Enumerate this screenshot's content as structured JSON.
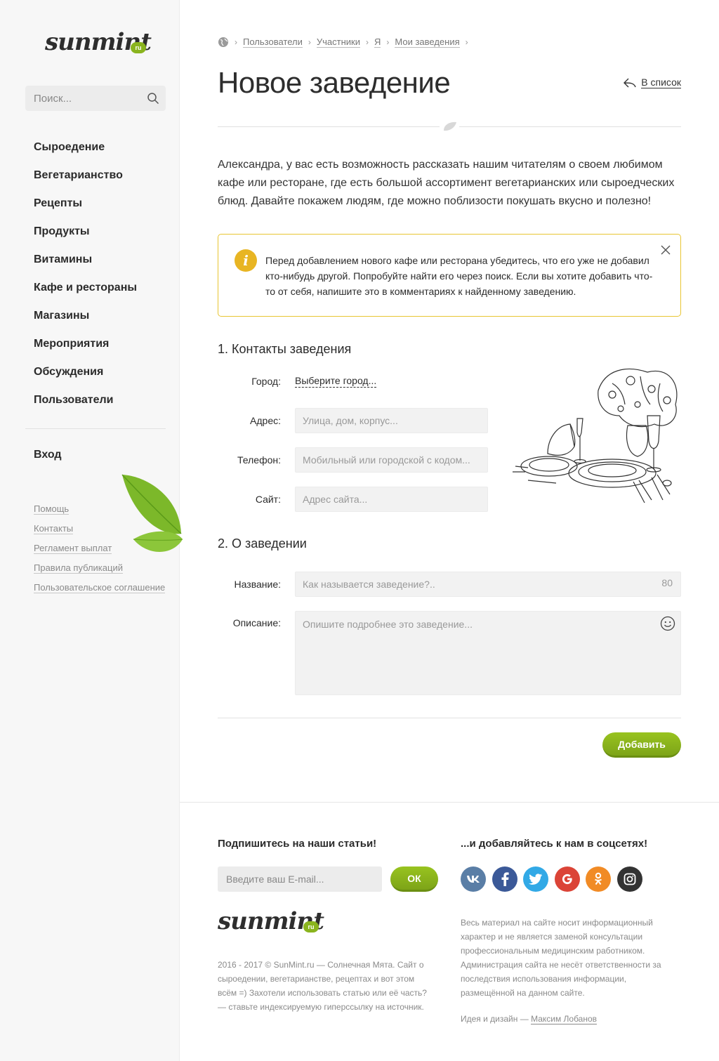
{
  "sidebar": {
    "logo_text": "sunmint",
    "logo_badge": "ru",
    "search_placeholder": "Поиск...",
    "nav": [
      "Сыроедение",
      "Вегетарианство",
      "Рецепты",
      "Продукты",
      "Витамины",
      "Кафе и рестораны",
      "Магазины",
      "Мероприятия",
      "Обсуждения",
      "Пользователи"
    ],
    "login": "Вход",
    "links": [
      "Помощь",
      "Контакты",
      "Регламент выплат",
      "Правила публикаций",
      "Пользовательское соглашение"
    ]
  },
  "breadcrumb": [
    "Пользователи",
    "Участники",
    "Я",
    "Мои заведения"
  ],
  "header": {
    "title": "Новое заведение",
    "back_link": "В список"
  },
  "intro": "Александра, у вас есть возможность рассказать нашим читателям о своем любимом кафе или ресторане, где есть большой ассортимент вегетарианских или сыроедческих блюд. Давайте покажем людям, где можно поблизости покушать вкусно и полезно!",
  "notice": {
    "icon": "i",
    "text": "Перед добавлением нового кафе или ресторана убедитесь, что его уже не добавил кто-нибудь другой. Попробуйте найти его через поиск. Если вы хотите добавить что-то от себя, напишите это в комментариях к найденному заведению."
  },
  "section1": {
    "title": "1. Контакты заведения",
    "city_label": "Город:",
    "city_value": "Выберите город...",
    "address_label": "Адрес:",
    "address_placeholder": "Улица, дом, корпус...",
    "phone_label": "Телефон:",
    "phone_placeholder": "Мобильный или городской с кодом...",
    "site_label": "Сайт:",
    "site_placeholder": "Адрес сайта..."
  },
  "section2": {
    "title": "2. О заведении",
    "name_label": "Название:",
    "name_placeholder": "Как называется заведение?..",
    "name_counter": "80",
    "desc_label": "Описание:",
    "desc_placeholder": "Опишите подробнее это заведение..."
  },
  "submit_label": "Добавить",
  "footer": {
    "subscribe_title": "Подпишитесь на наши статьи!",
    "email_placeholder": "Введите ваш E-mail...",
    "ok_label": "ОК",
    "social_title": "...и добавляйтесь к нам в соцсетях!",
    "socials": [
      {
        "name": "vk",
        "glyph": "vk",
        "color": "#5a7ea6"
      },
      {
        "name": "facebook",
        "glyph": "f",
        "color": "#3b5998"
      },
      {
        "name": "twitter",
        "glyph": "t",
        "color": "#32a9e6"
      },
      {
        "name": "google",
        "glyph": "G",
        "color": "#db4437"
      },
      {
        "name": "odnoklassniki",
        "glyph": "ok",
        "color": "#f18b25"
      },
      {
        "name": "instagram",
        "glyph": "ig",
        "color": "#333333"
      }
    ],
    "copyright": "2016 - 2017 © SunMint.ru — Солнечная Мята. Сайт о сыроедении, вегетарианстве, рецептах и вот этом всём =) Захотели использовать статью или её часть? — ставьте индексируемую гиперссылку на источник.",
    "disclaimer": "Весь материал на сайте носит информационный характер и не является заменой консультации профессиональным медицинским работником. Администрация сайта не несёт ответственности за последствия использования информации, размещённой на данном сайте.",
    "credit_prefix": "Идея и дизайн — ",
    "credit_author": "Максим Лобанов"
  },
  "colors": {
    "accent_green": "#8ab41e",
    "notice_border": "#e8c532",
    "info_icon": "#e8b523"
  }
}
